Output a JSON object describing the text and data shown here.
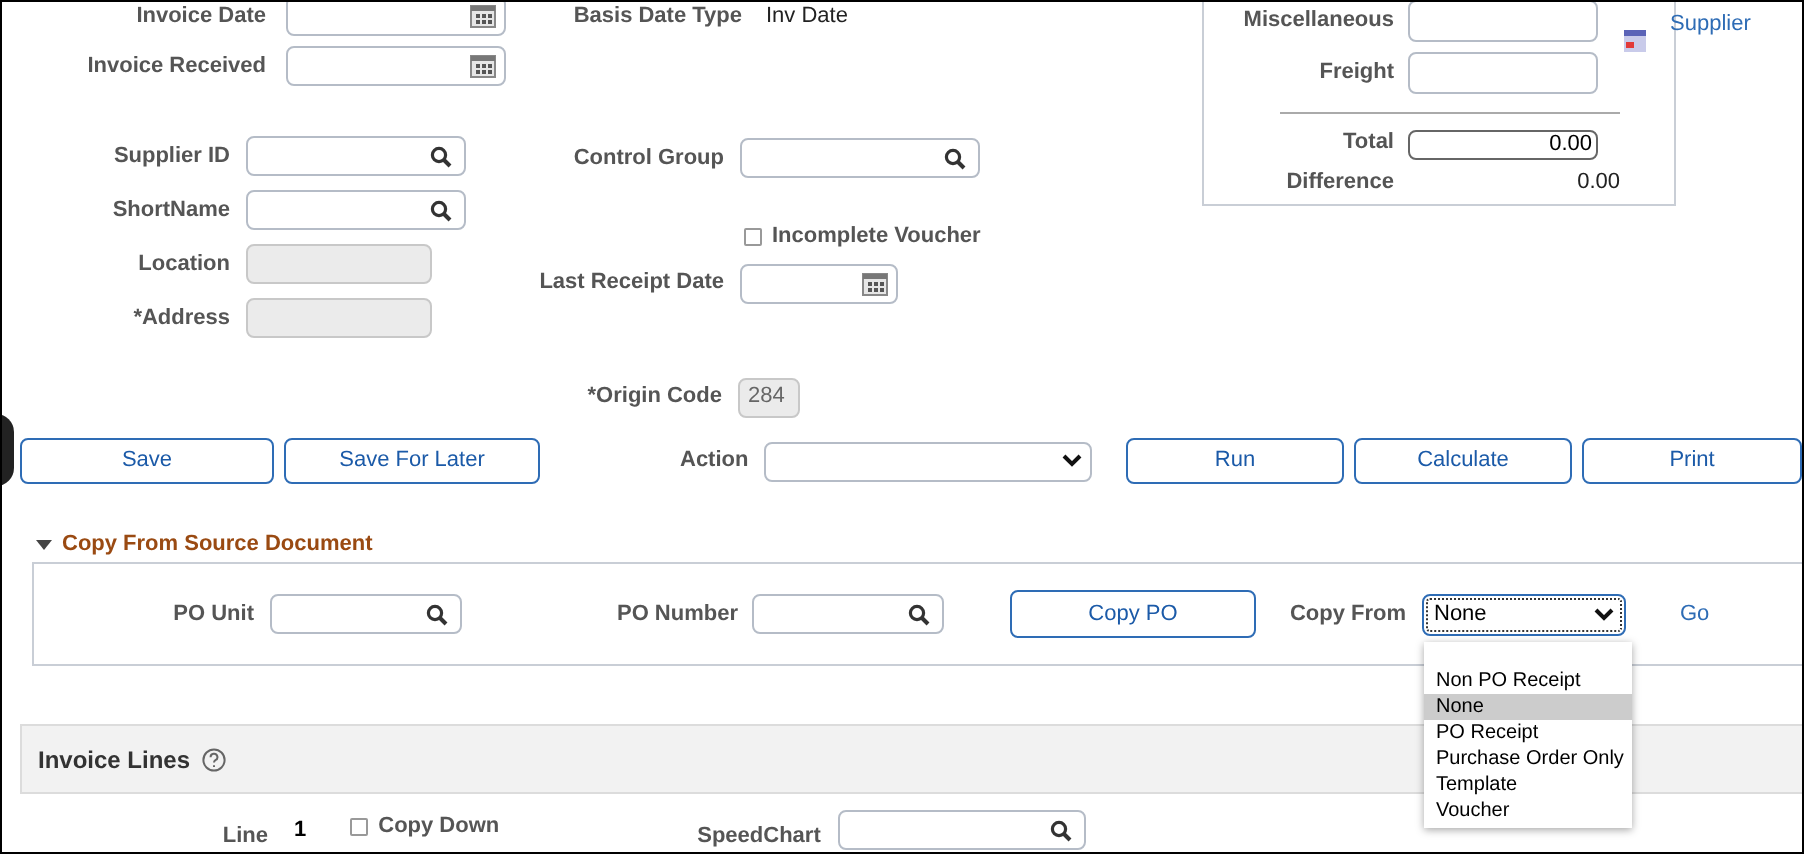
{
  "invoice_fields": [
    {
      "label": "Invoice Date",
      "kind": "date"
    },
    {
      "label": "Invoice Received",
      "kind": "date"
    }
  ],
  "supplier_fields": [
    {
      "label": "Supplier ID",
      "kind": "lookup"
    },
    {
      "label": "ShortName",
      "kind": "lookup"
    },
    {
      "label": "Location",
      "kind": "disabled"
    },
    {
      "label": "*Address",
      "kind": "disabled"
    }
  ],
  "basis_date_type": {
    "label": "Basis Date Type",
    "value": "Inv Date"
  },
  "control_group": {
    "label": "Control Group",
    "kind": "lookup"
  },
  "incomplete_voucher": {
    "label": "Incomplete Voucher",
    "checked": false
  },
  "last_receipt_date": {
    "label": "Last Receipt Date",
    "kind": "date"
  },
  "origin_code": {
    "label": "*Origin Code",
    "value": "284",
    "kind": "disabled"
  },
  "totals": [
    {
      "label": "Miscellaneous",
      "kind": "input"
    },
    {
      "label": "Freight",
      "kind": "input"
    },
    {
      "label": "Total",
      "kind": "output",
      "value": "0.00"
    },
    {
      "label": "Difference",
      "kind": "text",
      "value": "0.00"
    }
  ],
  "supplier_link": "Supplier",
  "buttons_left": [
    "Save",
    "Save For Later"
  ],
  "action": {
    "label": "Action"
  },
  "buttons_right": [
    "Run",
    "Calculate",
    "Print"
  ],
  "copy_section": {
    "title": "Copy From Source Document",
    "expanded": true,
    "po_unit": {
      "label": "PO Unit"
    },
    "po_number": {
      "label": "PO Number"
    },
    "copy_button": "Copy PO",
    "copy_from": {
      "label": "Copy From",
      "value": "None",
      "open": true,
      "options": [
        {
          "label": "Non PO Receipt",
          "selected": false
        },
        {
          "label": "None",
          "selected": true
        },
        {
          "label": "PO Receipt",
          "selected": false
        },
        {
          "label": "Purchase Order Only",
          "selected": false
        },
        {
          "label": "Template",
          "selected": false
        },
        {
          "label": "Voucher",
          "selected": false
        }
      ]
    },
    "go_link": "Go"
  },
  "invoice_lines": {
    "title": "Invoice Lines",
    "line": {
      "label": "Line",
      "value": "1"
    },
    "copy_down": {
      "label": "Copy Down",
      "checked": false
    },
    "speedchart": {
      "label": "SpeedChart"
    }
  }
}
